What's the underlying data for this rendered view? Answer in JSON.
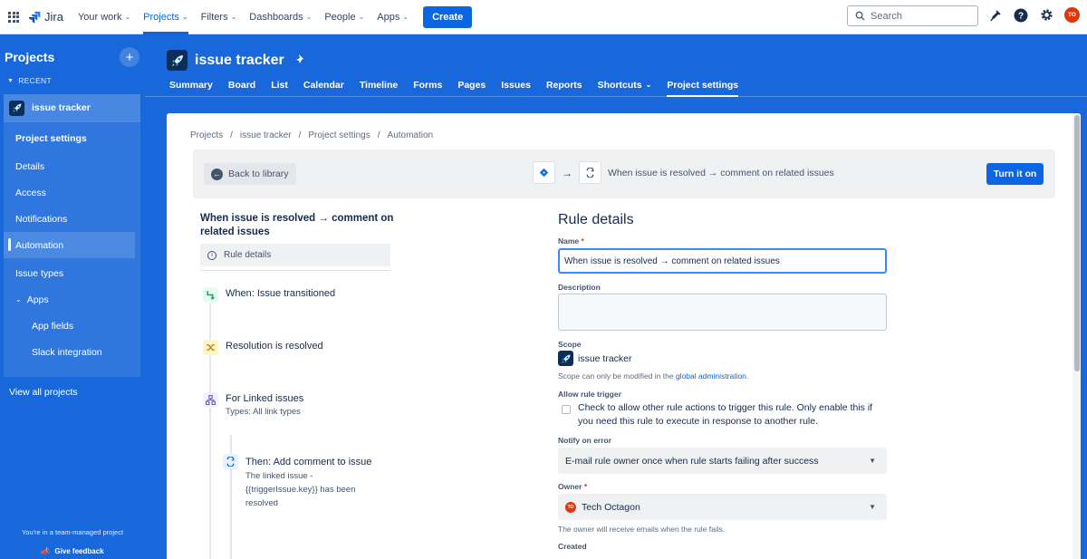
{
  "topnav": {
    "logo_text": "Jira",
    "menu": [
      {
        "label": "Your work",
        "active": false
      },
      {
        "label": "Projects",
        "active": true
      },
      {
        "label": "Filters",
        "active": false
      },
      {
        "label": "Dashboards",
        "active": false
      },
      {
        "label": "People",
        "active": false
      },
      {
        "label": "Apps",
        "active": false
      }
    ],
    "create_label": "Create",
    "search_placeholder": "Search",
    "avatar_initials": "TO"
  },
  "sidebar": {
    "title": "Projects",
    "recent_label": "RECENT",
    "project_name": "issue tracker",
    "settings_heading": "Project settings",
    "items": [
      "Details",
      "Access",
      "Notifications",
      "Automation",
      "Issue types"
    ],
    "active_item": "Automation",
    "apps_label": "Apps",
    "app_items": [
      "App fields",
      "Slack integration"
    ],
    "view_all": "View all projects",
    "footer_text": "You're in a team-managed project",
    "feedback_label": "Give feedback"
  },
  "project": {
    "name": "issue tracker",
    "tabs": [
      "Summary",
      "Board",
      "List",
      "Calendar",
      "Timeline",
      "Forms",
      "Pages",
      "Issues",
      "Reports",
      "Shortcuts",
      "Project settings"
    ],
    "active_tab": "Project settings"
  },
  "breadcrumbs": [
    "Projects",
    "/",
    "issue tracker",
    "/",
    "Project settings",
    "/",
    "Automation"
  ],
  "toolbar": {
    "back_label": "Back to library",
    "flow_text": "When issue is resolved → comment on related issues",
    "turn_on_label": "Turn it on"
  },
  "outline": {
    "title": "When issue is resolved → comment on related issues",
    "rule_details_label": "Rule details",
    "trigger": "When: Issue transitioned",
    "condition": "Resolution is resolved",
    "branch": "For Linked issues",
    "branch_sub": "Types: All link types",
    "action": "Then: Add comment to issue",
    "action_sub": "The linked issue - {{triggerIssue.key}} has been resolved"
  },
  "form": {
    "title": "Rule details",
    "name_label": "Name",
    "name_value": "When issue is resolved → comment on related issues",
    "description_label": "Description",
    "scope_label": "Scope",
    "scope_value": "issue tracker",
    "scope_helper_prefix": "Scope can only be modified in the ",
    "scope_helper_link": "global administration",
    "scope_helper_suffix": ".",
    "allow_trigger_label": "Allow rule trigger",
    "allow_trigger_text": "Check to allow other rule actions to trigger this rule. Only enable this if you need this rule to execute in response to another rule.",
    "notify_label": "Notify on error",
    "notify_value": "E-mail rule owner once when rule starts failing after success",
    "owner_label": "Owner",
    "owner_value": "Tech Octagon",
    "owner_initials": "TO",
    "owner_helper": "The owner will receive emails when the rule fails.",
    "created_label": "Created"
  },
  "colors": {
    "brand_blue": "#1868db",
    "primary_button": "#0c66e4",
    "focus_border": "#388bff",
    "required": "#de350b"
  }
}
